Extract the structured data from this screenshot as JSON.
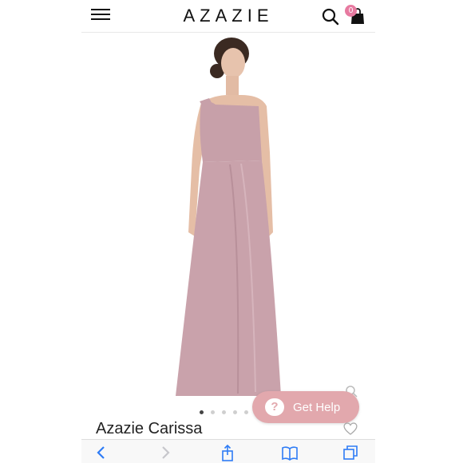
{
  "header": {
    "brand": "AZAZIE",
    "cart_count": "0",
    "icons": [
      "menu-icon",
      "search-icon",
      "shopping-bag-icon"
    ]
  },
  "product": {
    "title": "Azazie Carissa",
    "image_description": "one-shoulder dusty rose floor-length gown",
    "dress_color": "#c9a2ab",
    "carousel_dots": 5,
    "carousel_active_index": 0
  },
  "help": {
    "label": "Get Help",
    "icon": "?",
    "color": "#e2a8ad"
  },
  "browser_toolbar": {
    "icons": [
      "back-arrow-icon",
      "forward-arrow-icon",
      "share-icon",
      "bookmarks-icon",
      "tabs-icon"
    ],
    "accent": "#2e7cf6"
  },
  "colors": {
    "badge": "#e77aa0"
  }
}
